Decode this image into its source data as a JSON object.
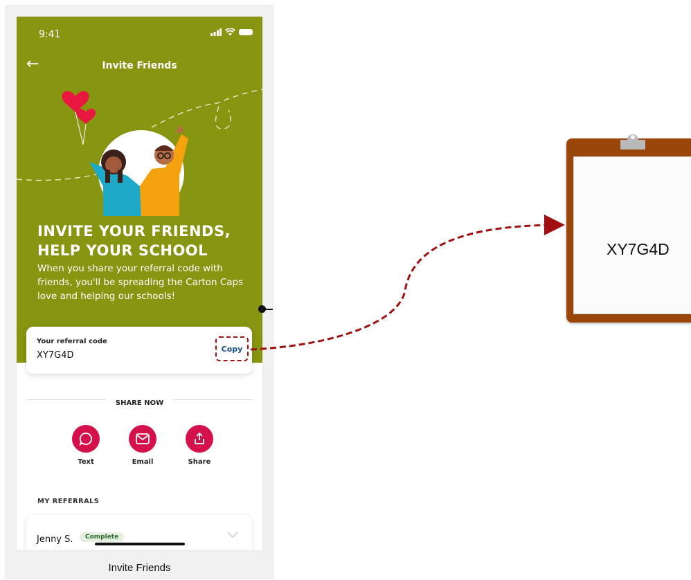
{
  "status_bar": {
    "time": "9:41"
  },
  "nav": {
    "title": "Invite Friends"
  },
  "hero": {
    "headline_line1": "INVITE YOUR FRIENDS,",
    "headline_line2": "HELP YOUR SCHOOL",
    "subtext": "When you share your referral code with friends, you'll be spreading the Carton Caps love and helping our schools!"
  },
  "referral": {
    "label": "Your referral code",
    "code": "XY7G4D",
    "copy_label": "Copy"
  },
  "share": {
    "title": "SHARE NOW",
    "items": [
      {
        "label": "Text",
        "icon": "message-bubble-icon"
      },
      {
        "label": "Email",
        "icon": "envelope-icon"
      },
      {
        "label": "Share",
        "icon": "share-upload-icon"
      }
    ]
  },
  "my_referrals": {
    "title": "MY REFERRALS",
    "rows": [
      {
        "name": "Jenny S.",
        "status": "Complete"
      }
    ]
  },
  "caption": "Invite Friends",
  "clipboard": {
    "text": "XY7G4D"
  },
  "colors": {
    "hero_green": "#879510",
    "accent_red": "#d5114b",
    "clipboard_brown": "#9a4509",
    "annotation_red": "#a01010"
  }
}
